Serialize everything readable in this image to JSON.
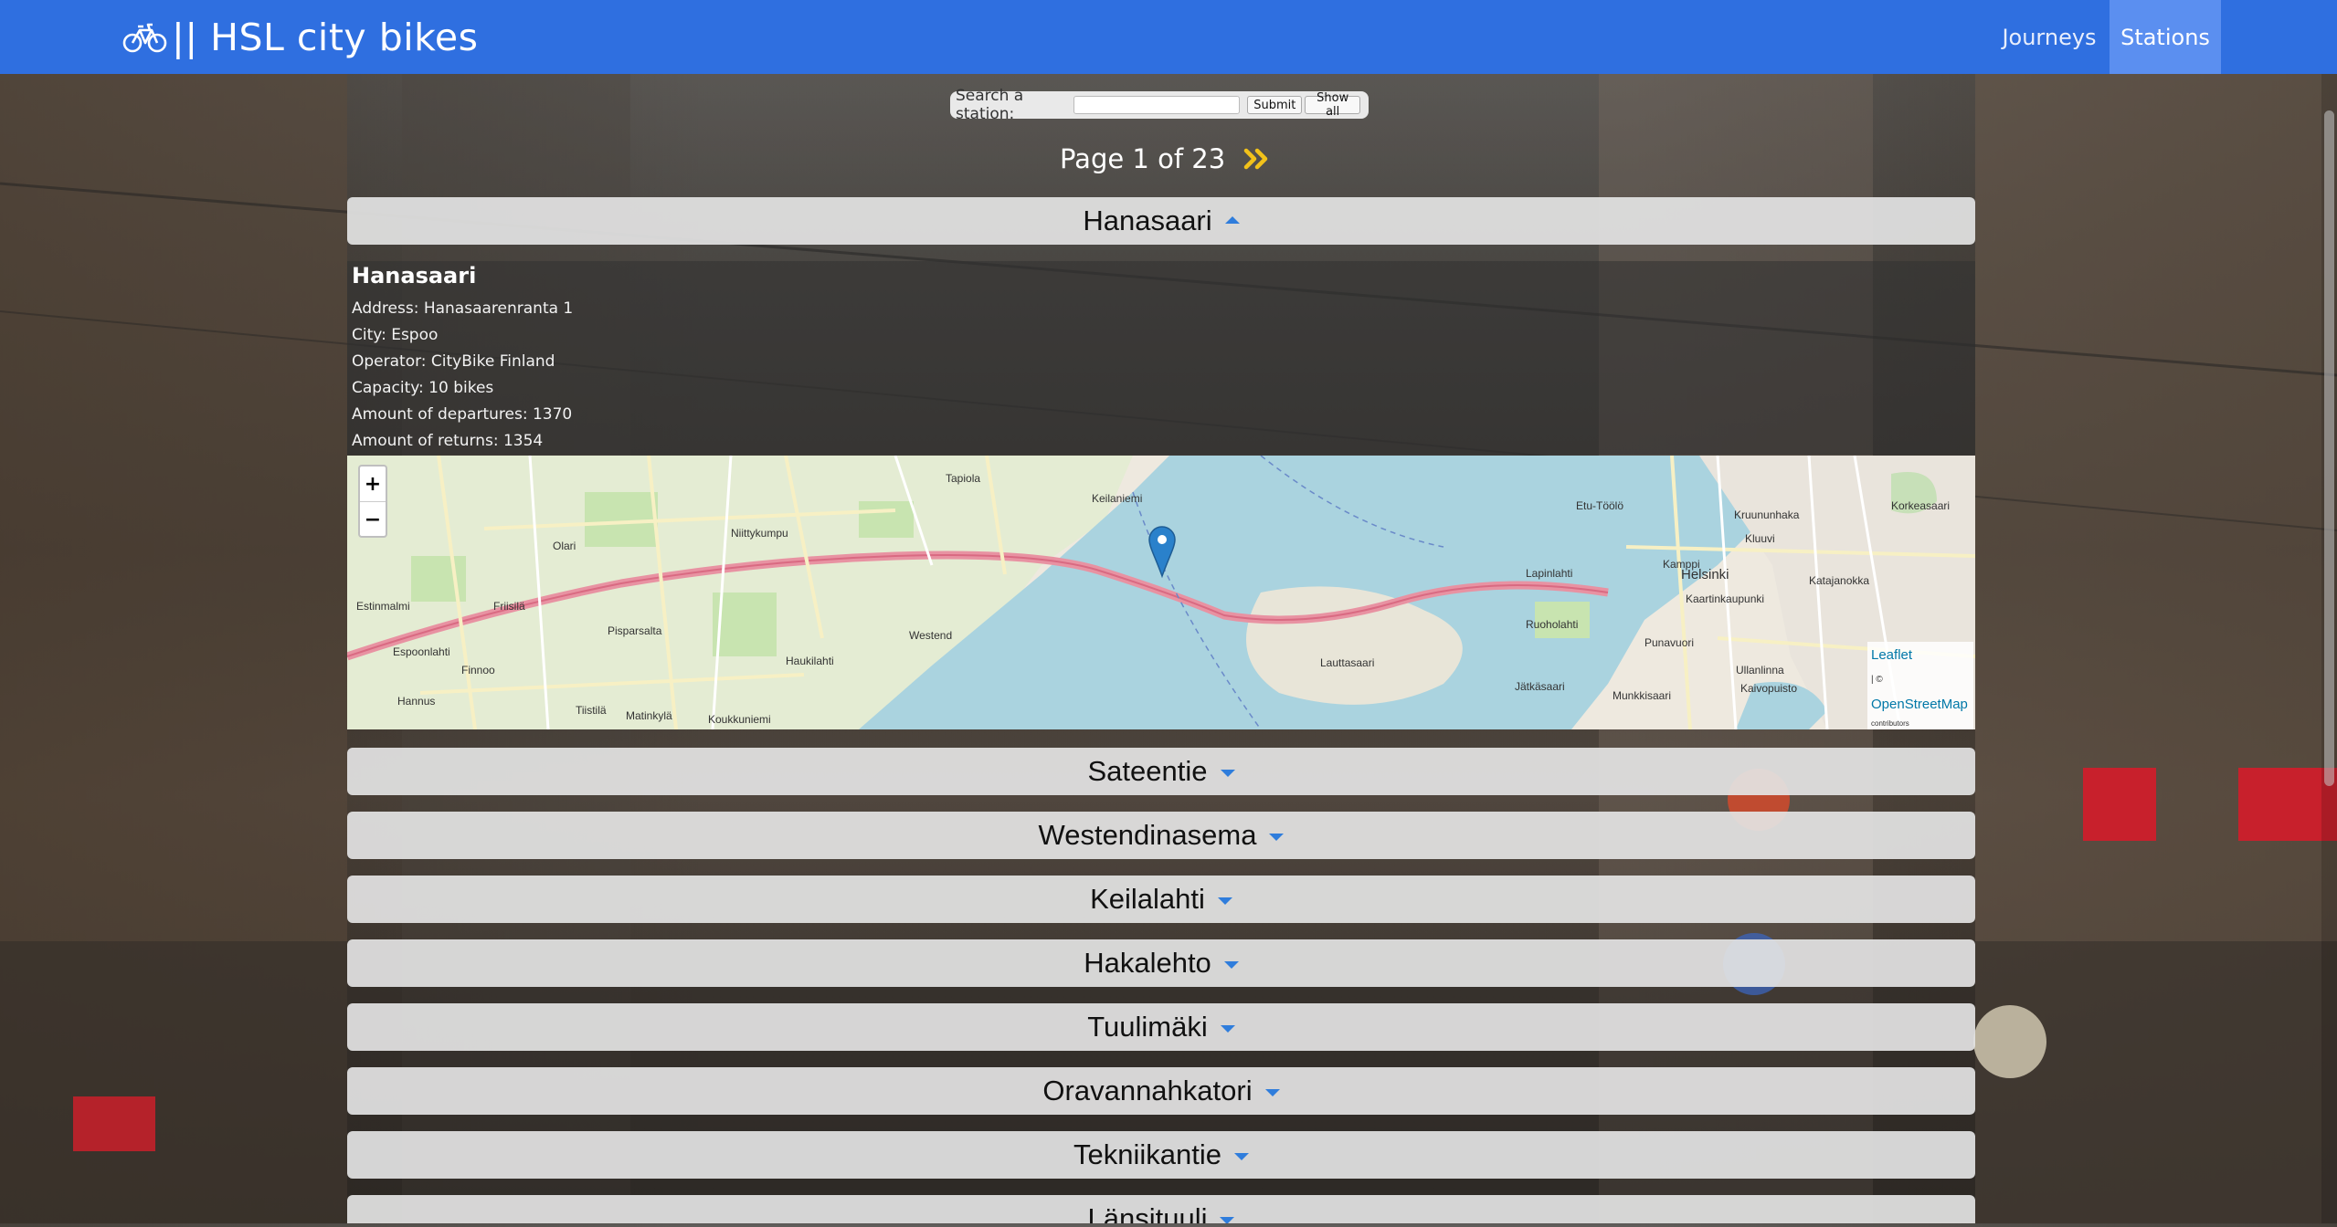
{
  "navbar": {
    "brand": "|| HSL city bikes",
    "links": {
      "journeys": "Journeys",
      "stations": "Stations"
    },
    "active_color": "#5b8ff0",
    "bar_color": "#2f6fe0"
  },
  "search": {
    "label": "Search a station:",
    "value": "",
    "submit_label": "Submit",
    "show_all_label": "Show all"
  },
  "pagination": {
    "text": "Page 1 of 23",
    "next_icon": "double-chevron-right-icon",
    "icon_color": "#f2c21a"
  },
  "stations": [
    {
      "name": "Hanasaari",
      "expanded": true
    },
    {
      "name": "Sateentie",
      "expanded": false
    },
    {
      "name": "Westendinasema",
      "expanded": false
    },
    {
      "name": "Keilalahti",
      "expanded": false
    },
    {
      "name": "Hakalehto",
      "expanded": false
    },
    {
      "name": "Tuulimäki",
      "expanded": false
    },
    {
      "name": "Oravannahkatori",
      "expanded": false
    },
    {
      "name": "Tekniikantie",
      "expanded": false
    },
    {
      "name": "Länsituuli",
      "expanded": false
    }
  ],
  "details": {
    "title": "Hanasaari",
    "address": "Address: Hanasaarenranta 1",
    "city": "City: Espoo",
    "operator": "Operator: CityBike Finland",
    "capacity": "Capacity: 10 bikes",
    "departures": "Amount of departures: 1370",
    "returns": "Amount of returns: 1354"
  },
  "map": {
    "zoom_in": "+",
    "zoom_out": "−",
    "attribution_leaflet": "Leaflet",
    "attribution_sep": "| ©",
    "attribution_osm": "OpenStreetMap",
    "attribution_contrib": "contributors",
    "labels": [
      "Tapiola",
      "Keilaniemi",
      "Niittykumpu",
      "Olari",
      "Westend",
      "Haukilahti",
      "Espoonlahti",
      "Lauttasaari",
      "Helsinki",
      "Kamppi",
      "Etu-Töölö",
      "Kruununhaka",
      "Katajanokka",
      "Punavuori",
      "Ullanlinna",
      "Kaivopuisto",
      "Munkkisaari",
      "Jätkäsaari",
      "Ruoholahti",
      "Lapinlahti",
      "Finnoo",
      "Hannus",
      "Matinkylä",
      "Koukkuniemi",
      "Tiistilä",
      "Pisparsalta",
      "Friisilä",
      "Estinmalmi",
      "Korkeasaari",
      "Kluuvi",
      "Kaartinkaupunki"
    ]
  }
}
